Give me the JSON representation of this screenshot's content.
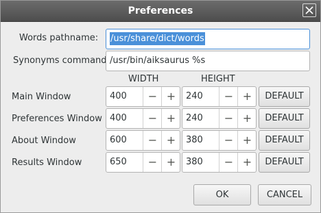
{
  "window": {
    "title": "Preferences"
  },
  "words": {
    "label": "Words pathname:",
    "value": "/usr/share/dict/words"
  },
  "synonyms": {
    "label": "Synonyms command:",
    "value": "/usr/bin/aiksaurus %s"
  },
  "columns": {
    "width": "WIDTH",
    "height": "HEIGHT"
  },
  "rows": [
    {
      "label": "Main Window",
      "width": "400",
      "height": "240",
      "default": "DEFAULT"
    },
    {
      "label": "Preferences Window",
      "width": "400",
      "height": "240",
      "default": "DEFAULT"
    },
    {
      "label": "About Window",
      "width": "600",
      "height": "380",
      "default": "DEFAULT"
    },
    {
      "label": "Results Window",
      "width": "650",
      "height": "380",
      "default": "DEFAULT"
    }
  ],
  "spin": {
    "minus": "−",
    "plus": "+"
  },
  "footer": {
    "ok": "OK",
    "cancel": "CANCEL"
  },
  "icons": {
    "close": "close-icon"
  },
  "colors": {
    "titlebar": "#5a5a5a",
    "selection": "#4a90d9",
    "background": "#ededed"
  }
}
